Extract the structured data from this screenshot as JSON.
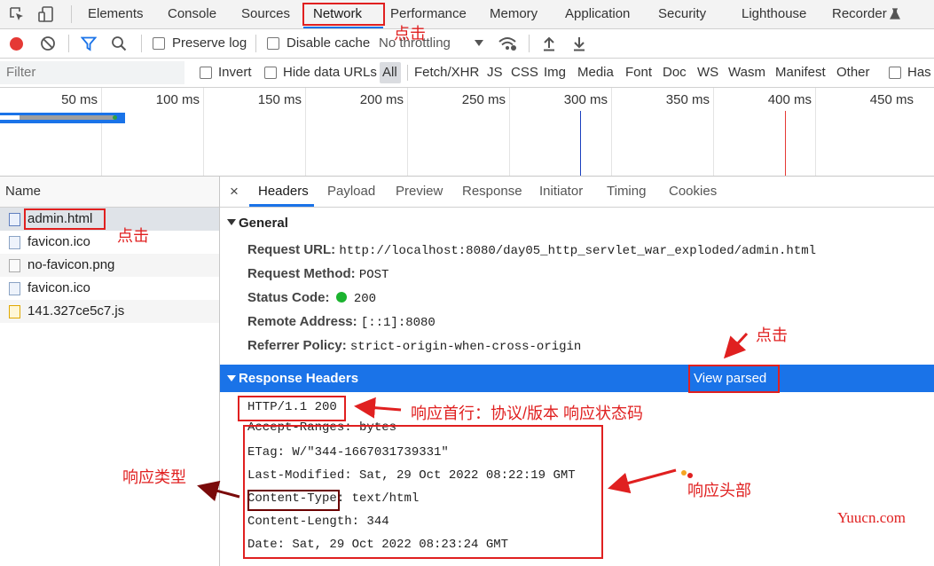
{
  "devtools_tabs": [
    "Elements",
    "Console",
    "Sources",
    "Network",
    "Performance",
    "Memory",
    "Application",
    "Security",
    "Lighthouse",
    "Recorder"
  ],
  "toolbar": {
    "preserve_log": "Preserve log",
    "disable_cache": "Disable cache",
    "throttling": "No throttling"
  },
  "filter": {
    "placeholder": "Filter",
    "invert": "Invert",
    "hide_data_urls": "Hide data URLs",
    "types": [
      "All",
      "Fetch/XHR",
      "JS",
      "CSS",
      "Img",
      "Media",
      "Font",
      "Doc",
      "WS",
      "Wasm",
      "Manifest",
      "Other"
    ],
    "has_blocked": "Has"
  },
  "timeline": {
    "ticks": [
      "50 ms",
      "100 ms",
      "150 ms",
      "200 ms",
      "250 ms",
      "300 ms",
      "350 ms",
      "400 ms",
      "450 ms"
    ]
  },
  "requests": {
    "header": "Name",
    "items": [
      "admin.html",
      "favicon.ico",
      "no-favicon.png",
      "favicon.ico",
      "141.327ce5c7.js"
    ]
  },
  "details": {
    "close": "×",
    "tabs": [
      "Headers",
      "Payload",
      "Preview",
      "Response",
      "Initiator",
      "Timing",
      "Cookies"
    ],
    "general": {
      "title": "General",
      "request_url_label": "Request URL:",
      "request_url": "http://localhost:8080/day05_http_servlet_war_exploded/admin.html",
      "request_method_label": "Request Method:",
      "request_method": "POST",
      "status_code_label": "Status Code:",
      "status_code": "200",
      "remote_address_label": "Remote Address:",
      "remote_address": "[::1]:8080",
      "referrer_policy_label": "Referrer Policy:",
      "referrer_policy": "strict-origin-when-cross-origin"
    },
    "response_headers": {
      "title": "Response Headers",
      "view_parsed": "View parsed",
      "status_line": "HTTP/1.1 200",
      "accept_ranges": "Accept-Ranges: bytes",
      "etag": "ETag: W/\"344-1667031739331\"",
      "last_modified": "Last-Modified: Sat, 29 Oct 2022 08:22:19 GMT",
      "content_type_key": "Content-Type",
      "content_type_value": ": text/html",
      "content_length": "Content-Length: 344",
      "date": "Date: Sat, 29 Oct 2022 08:23:24 GMT"
    }
  },
  "annotations": {
    "click_network": "点击",
    "click_admin": "点击",
    "click_view_parsed": "点击",
    "first_line": "响应首行：协议/版本 响应状态码",
    "response_type": "响应类型",
    "response_headers": "响应头部",
    "watermark": "Yuucn.com"
  },
  "colors": {
    "accent": "#1a73e8",
    "record": "#e53935",
    "annotation": "#e02020",
    "selected_row": "#dfe3e8"
  }
}
